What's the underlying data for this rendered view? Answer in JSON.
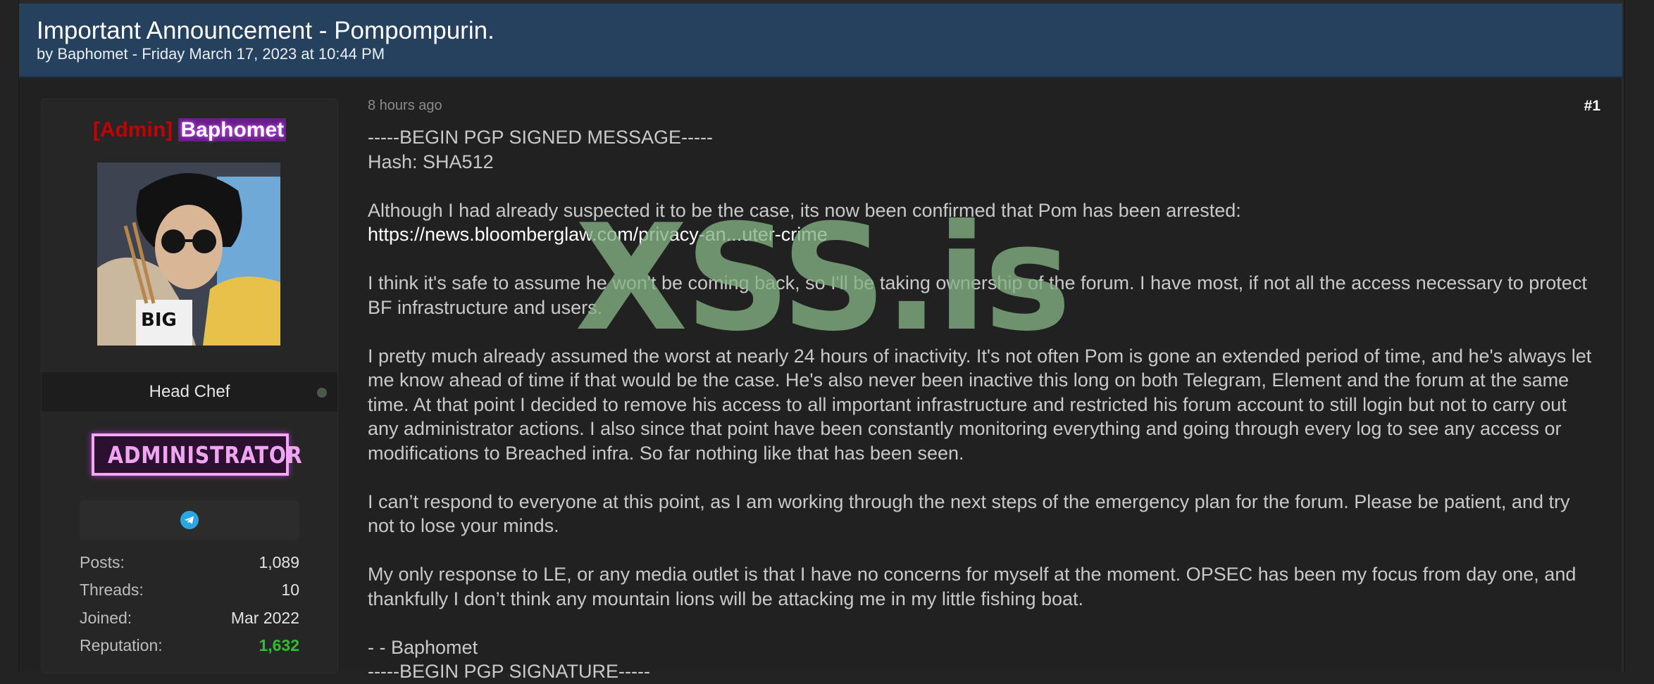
{
  "thread": {
    "title": "Important Announcement - Pompompurin.",
    "byline": "by Baphomet - Friday March 17, 2023 at 10:44 PM"
  },
  "user": {
    "rank_tag": "[Admin]",
    "username": "Baphomet",
    "role": "Head Chef",
    "badge": "ADMINISTRATOR",
    "contact_icon": "telegram-icon",
    "stats": [
      {
        "label": "Posts:",
        "value": "1,089"
      },
      {
        "label": "Threads:",
        "value": "10"
      },
      {
        "label": "Joined:",
        "value": "Mar 2022"
      },
      {
        "label": "Reputation:",
        "value": "1,632"
      }
    ]
  },
  "post": {
    "time": "8 hours ago",
    "number": "#1",
    "pgp_header": "-----BEGIN PGP SIGNED MESSAGE-----",
    "hash": "Hash: SHA512",
    "p1": "Although I had already suspected it to be the case, its now been confirmed that Pom has been arrested:",
    "link": "https://news.bloomberglaw.com/privacy-an...uter-crime",
    "p2": "I think it's safe to assume he won't be coming back, so I'll be taking ownership of the forum. I have most, if not all the access necessary to protect BF infrastructure and users.",
    "p3": "I pretty much already assumed the worst at nearly 24 hours of inactivity. It's not often Pom is gone an extended period of time, and he's always let me know ahead of time if that would be the case. He's also never been inactive this long on both Telegram, Element and the forum at the same time. At that point I decided to remove his access to all important infrastructure and restricted his forum account to still login but not to carry out any administrator actions. I also since that point have been constantly monitoring everything and going through every log to see any access or modifications to Breached infra. So far nothing like that has been seen.",
    "p4": "I can’t respond to everyone at this point, as I am working through the next steps of the emergency plan for the forum. Please be patient, and try not to lose your minds.",
    "p5": "My only response to LE, or any media outlet is that I have no concerns for myself at the moment. OPSEC has been my focus from day one, and thankfully I don’t think any mountain lions will be attacking me in my little fishing boat.",
    "signoff": "- - Baphomet",
    "pgp_sig": "-----BEGIN PGP SIGNATURE-----"
  },
  "watermark": "XSS.is",
  "colors": {
    "header_bg": "#26415e",
    "admin_red": "#c40000",
    "reputation_green": "#2fbf2f",
    "badge_pink": "#f0a4f2",
    "telegram_blue": "#2ca5e0"
  }
}
